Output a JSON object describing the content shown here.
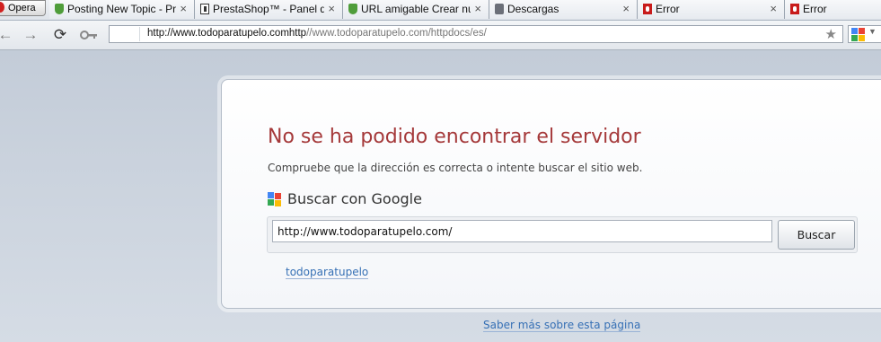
{
  "browser": {
    "menu_label": "Opera",
    "tabs": [
      {
        "title": "Posting New Topic - Pr...",
        "icon": "leaf-icon"
      },
      {
        "title": "PrestaShop™ - Panel d...",
        "icon": "prestashop-icon"
      },
      {
        "title": "URL amigable Crear nu...",
        "icon": "leaf-icon"
      },
      {
        "title": "Descargas",
        "icon": "download-icon"
      },
      {
        "title": "Error",
        "icon": "error-icon"
      },
      {
        "title": "Error",
        "icon": "error-icon"
      }
    ],
    "close_glyph": "×",
    "address": {
      "domain": "http://www.todoparatupelo.comhttp",
      "rest": "//www.todoparatupelo.com/httpdocs/es/"
    }
  },
  "error_page": {
    "title": "No se ha podido encontrar el servidor",
    "description": "Compruebe que la dirección es correcta o intente buscar el sitio web.",
    "search_heading": "Buscar con Google",
    "search_value": "http://www.todoparatupelo.com/",
    "search_button": "Buscar",
    "suggestion": "todoparatupelo",
    "more_info": "Saber más sobre esta página"
  },
  "colors": {
    "title": "#a5393a",
    "link": "#3670b5",
    "google": [
      "#4285f4",
      "#ea4335",
      "#fbbc05",
      "#34a853"
    ]
  }
}
